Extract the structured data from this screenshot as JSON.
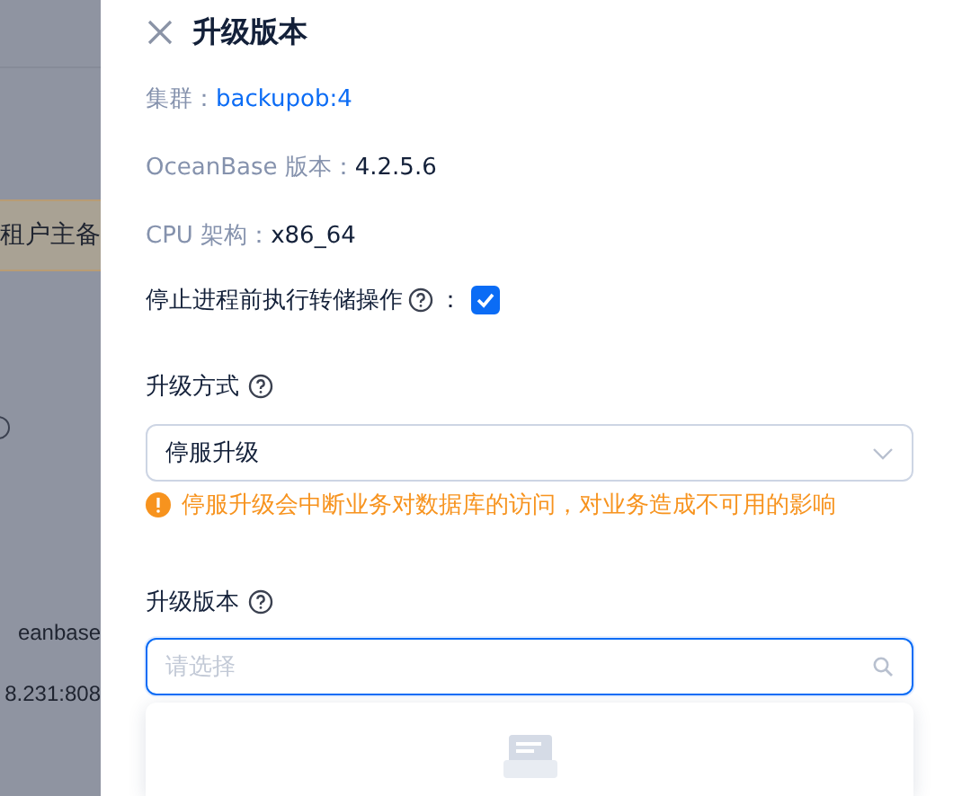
{
  "background": {
    "tag": "租户主备",
    "texts": [
      "eanbase",
      "8.231:808"
    ]
  },
  "drawer": {
    "title": "升级版本",
    "info": [
      {
        "label": "集群：",
        "value": "backupob:4",
        "kind": "link"
      },
      {
        "label": "OceanBase 版本：",
        "value": "4.2.5.6",
        "kind": "plain"
      },
      {
        "label": "CPU 架构：",
        "value": "x86_64",
        "kind": "plain"
      }
    ],
    "dump_option": {
      "label": "停止进程前执行转储操作",
      "colon": "：",
      "checked": true
    },
    "mode": {
      "label": "升级方式",
      "value": "停服升级",
      "warning": "停服升级会中断业务对数据库的访问，对业务造成不可用的影响"
    },
    "version": {
      "label": "升级版本",
      "placeholder": "请选择",
      "focused": true
    }
  }
}
